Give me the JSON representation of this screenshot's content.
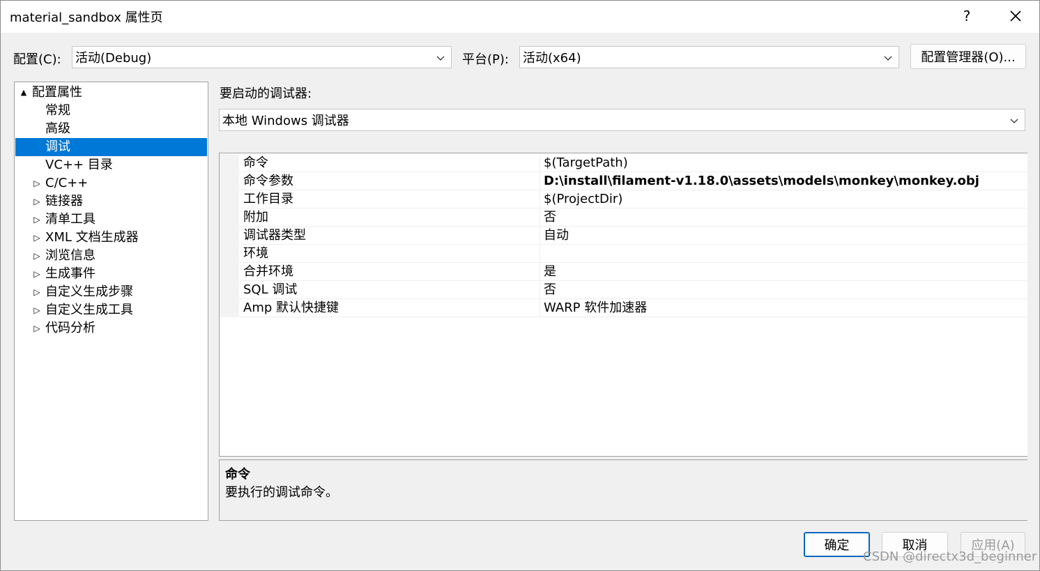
{
  "window": {
    "title": "material_sandbox 属性页",
    "help_label": "?"
  },
  "config_bar": {
    "config_label": "配置(C):",
    "config_value": "活动(Debug)",
    "platform_label": "平台(P):",
    "platform_value": "活动(x64)",
    "manager_button": "配置管理器(O)..."
  },
  "tree": {
    "items": [
      {
        "label": "配置属性",
        "expander": "▲",
        "level": 0
      },
      {
        "label": "常规",
        "expander": "",
        "level": 1
      },
      {
        "label": "高级",
        "expander": "",
        "level": 1
      },
      {
        "label": "调试",
        "expander": "",
        "level": 1,
        "selected": true
      },
      {
        "label": "VC++ 目录",
        "expander": "",
        "level": 1
      },
      {
        "label": "C/C++",
        "expander": "▷",
        "level": 1
      },
      {
        "label": "链接器",
        "expander": "▷",
        "level": 1
      },
      {
        "label": "清单工具",
        "expander": "▷",
        "level": 1
      },
      {
        "label": "XML 文档生成器",
        "expander": "▷",
        "level": 1
      },
      {
        "label": "浏览信息",
        "expander": "▷",
        "level": 1
      },
      {
        "label": "生成事件",
        "expander": "▷",
        "level": 1
      },
      {
        "label": "自定义生成步骤",
        "expander": "▷",
        "level": 1
      },
      {
        "label": "自定义生成工具",
        "expander": "▷",
        "level": 1
      },
      {
        "label": "代码分析",
        "expander": "▷",
        "level": 1
      }
    ]
  },
  "debugger": {
    "label": "要启动的调试器:",
    "value": "本地 Windows 调试器"
  },
  "properties": [
    {
      "name": "命令",
      "value": "$(TargetPath)",
      "bold": false
    },
    {
      "name": "命令参数",
      "value": "D:\\install\\filament-v1.18.0\\assets\\models\\monkey\\monkey.obj",
      "bold": true
    },
    {
      "name": "工作目录",
      "value": "$(ProjectDir)",
      "bold": false
    },
    {
      "name": "附加",
      "value": "否",
      "bold": false
    },
    {
      "name": "调试器类型",
      "value": "自动",
      "bold": false
    },
    {
      "name": "环境",
      "value": "",
      "bold": false
    },
    {
      "name": "合并环境",
      "value": "是",
      "bold": false
    },
    {
      "name": "SQL 调试",
      "value": "否",
      "bold": false
    },
    {
      "name": "Amp 默认快捷键",
      "value": "WARP 软件加速器",
      "bold": false
    }
  ],
  "description": {
    "title": "命令",
    "body": "要执行的调试命令。"
  },
  "buttons": {
    "ok": "确定",
    "cancel": "取消",
    "apply": "应用(A)"
  },
  "watermark": "CSDN @directx3d_beginner",
  "colors": {
    "selection": "#0078d7",
    "default_button_border": "#0067c0"
  }
}
